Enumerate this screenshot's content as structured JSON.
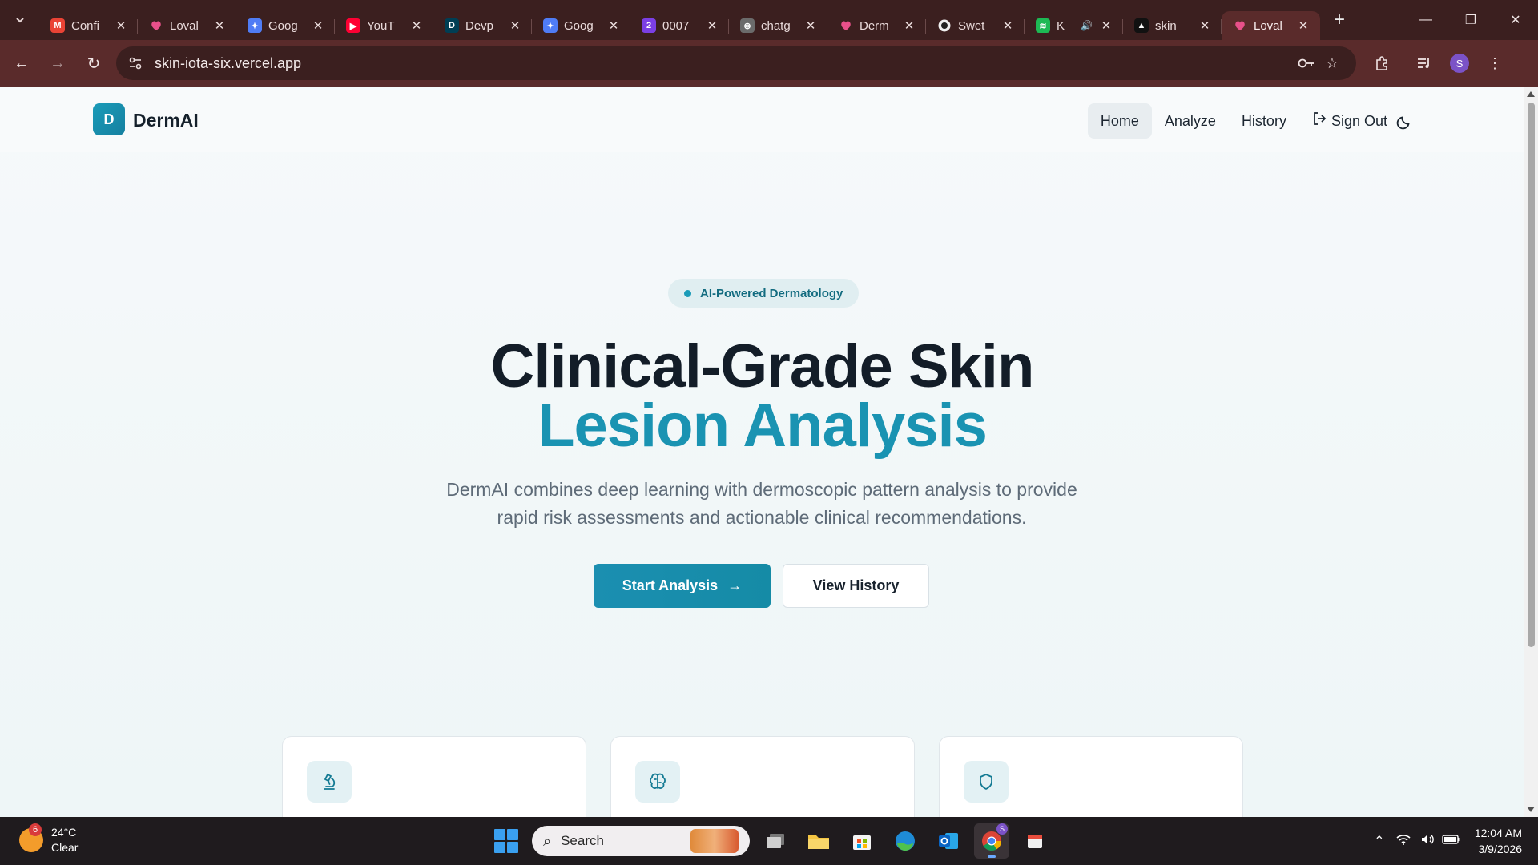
{
  "browser": {
    "tabs": [
      {
        "title": "Confi",
        "icon": "gmail-icon",
        "color": "#ea4335",
        "glyph": "M"
      },
      {
        "title": "Loval",
        "icon": "lovable-icon",
        "color": "#e8508a",
        "glyph": ""
      },
      {
        "title": "Goog",
        "icon": "gemini-icon",
        "color": "#4f7cf5",
        "glyph": "✦"
      },
      {
        "title": "YouT",
        "icon": "youtube-icon",
        "color": "#ff0033",
        "glyph": "▶"
      },
      {
        "title": "Devp",
        "icon": "devpost-icon",
        "color": "#003e54",
        "glyph": "D"
      },
      {
        "title": "Goog",
        "icon": "gemini-icon",
        "color": "#4f7cf5",
        "glyph": "✦"
      },
      {
        "title": "0007",
        "icon": "app-icon",
        "color": "#7b3fe4",
        "glyph": "2"
      },
      {
        "title": "chatg",
        "icon": "openai-icon",
        "color": "#6b6b6b",
        "glyph": "⊛"
      },
      {
        "title": "Derm",
        "icon": "lovable-icon",
        "color": "#e8508a",
        "glyph": ""
      },
      {
        "title": "Swet",
        "icon": "github-icon",
        "color": "#f0f0f0",
        "glyph": "●"
      },
      {
        "title": "K",
        "icon": "spotify-icon",
        "color": "#1db954",
        "glyph": "≋"
      },
      {
        "title": "skin",
        "icon": "vercel-icon",
        "color": "#111111",
        "glyph": "▲"
      },
      {
        "title": "Loval",
        "icon": "lovable-icon",
        "color": "#e8508a",
        "glyph": "",
        "active": true
      }
    ],
    "url": "skin-iota-six.vercel.app",
    "profile_initial": "S"
  },
  "site": {
    "logo_letter": "D",
    "logo_text": "DermAI",
    "nav": {
      "home": "Home",
      "analyze": "Analyze",
      "history": "History",
      "sign_out": "Sign Out"
    },
    "hero": {
      "badge": "AI-Powered Dermatology",
      "title_line1": "Clinical-Grade Skin",
      "title_line2": "Lesion Analysis",
      "subtitle": "DermAI combines deep learning with dermoscopic pattern analysis to provide rapid risk assessments and actionable clinical recommendations.",
      "primary_cta": "Start Analysis",
      "secondary_cta": "View History"
    },
    "feature_cards": [
      {
        "icon": "microscope-icon"
      },
      {
        "icon": "brain-icon"
      },
      {
        "icon": "shield-icon"
      }
    ],
    "colors": {
      "accent": "#1a93b2",
      "heading": "#131d28",
      "muted": "#5e6b78"
    }
  },
  "taskbar": {
    "weather_temp": "24°C",
    "weather_desc": "Clear",
    "weather_badge": "6",
    "search_placeholder": "Search",
    "time": "12:04 AM",
    "date": "3/9/2026"
  }
}
